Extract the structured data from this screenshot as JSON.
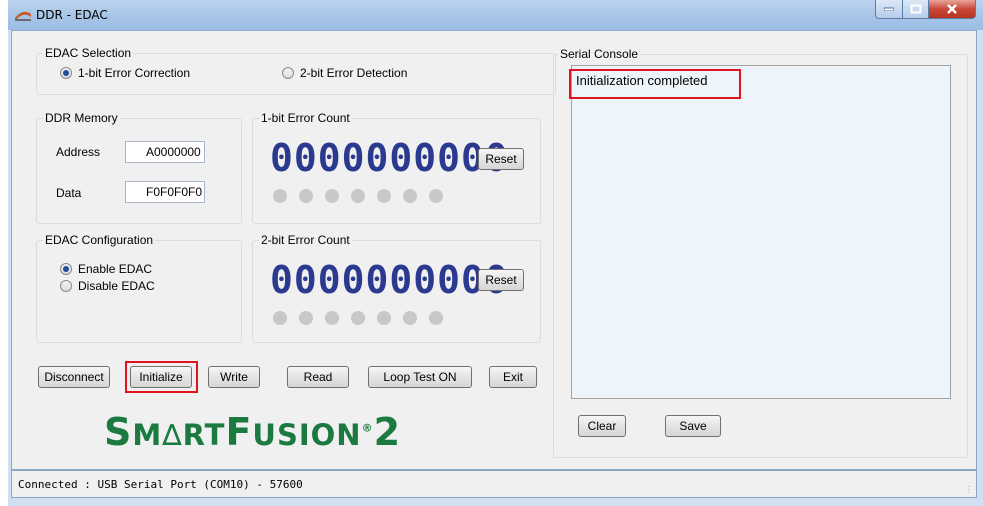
{
  "window": {
    "title": "DDR - EDAC"
  },
  "edac_selection": {
    "legend": "EDAC Selection",
    "options": [
      {
        "label": "1-bit Error Correction",
        "selected": true
      },
      {
        "label": "2-bit Error Detection",
        "selected": false
      }
    ]
  },
  "ddr_memory": {
    "legend": "DDR Memory",
    "address_label": "Address",
    "address_value": "A0000000",
    "data_label": "Data",
    "data_value": "F0F0F0F0"
  },
  "one_bit": {
    "legend": "1-bit Error Count",
    "count": "0000000000",
    "reset_label": "Reset"
  },
  "two_bit": {
    "legend": "2-bit Error Count",
    "count": "0000000000",
    "reset_label": "Reset"
  },
  "edac_config": {
    "legend": "EDAC Configuration",
    "options": [
      {
        "label": "Enable EDAC",
        "selected": true
      },
      {
        "label": "Disable EDAC",
        "selected": false
      }
    ]
  },
  "buttons": {
    "disconnect": "Disconnect",
    "initialize": "Initialize",
    "write": "Write",
    "read": "Read",
    "loop_test": "Loop Test ON",
    "exit": "Exit"
  },
  "logo": {
    "text_parts": [
      "S",
      "M",
      "∆",
      "RT",
      "F",
      "USION",
      "®",
      "2"
    ]
  },
  "console": {
    "legend": "Serial Console",
    "output": "Initialization completed",
    "clear_label": "Clear",
    "save_label": "Save"
  },
  "status_bar": {
    "text": "Connected : USB Serial Port (COM10) - 57600"
  },
  "colors": {
    "accent": "#1a7a40",
    "counter": "#2b3a8f",
    "highlight": "#e0141e"
  }
}
